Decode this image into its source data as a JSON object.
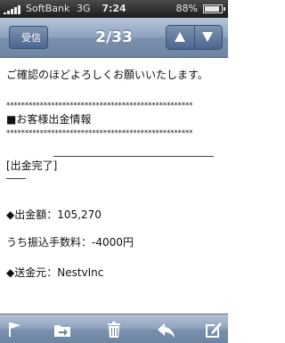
{
  "status_bar": {
    "carrier": "SoftBank",
    "network": "3G",
    "time": "7:24",
    "battery": "88%",
    "battery_level": 0.88
  },
  "nav": {
    "back_label": "受信",
    "counter": "2/33",
    "up_icon": "arrow-up-icon",
    "down_icon": "arrow-down-icon"
  },
  "message": {
    "greeting": "ご確認のほどよろしくお願いいたします。",
    "stars_top": "**************************************************",
    "section_title": "■お客様出金情報",
    "stars_bottom": "**************************************************",
    "status_label": "[出金完了]",
    "amount_line": "◆出金額：105,270",
    "fee_line": "うち振込手数料：-4000円",
    "sender_line": "◆送金元：NestvInc"
  },
  "toolbar": {
    "icons": [
      "flag-icon",
      "move-to-folder-icon",
      "trash-icon",
      "reply-icon",
      "compose-icon"
    ]
  },
  "colors": {
    "nav_blue": "#7b91ae",
    "status_bg": "#1c1c1c"
  }
}
